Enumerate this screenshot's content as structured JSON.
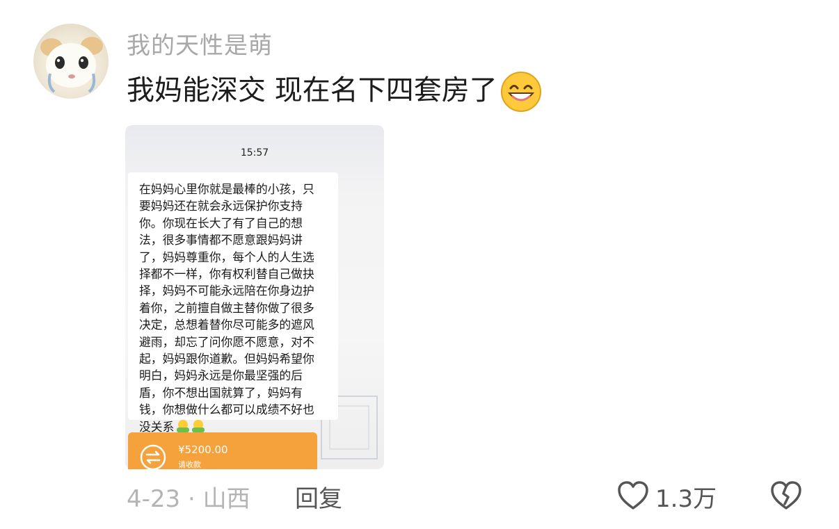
{
  "user": {
    "name": "我的天性是萌"
  },
  "comment": {
    "text": "我妈能深交 现在名下四套房了",
    "emoji": "grinning-face-emoji"
  },
  "screenshot": {
    "time": "15:57",
    "message": "在妈妈心里你就是最棒的小孩，只\n要妈妈还在就会永远保护你支持\n你。你现在长大了有了自己的想\n法，很多事情都不愿意跟妈妈讲\n了，妈妈尊重你，每个人的人生选\n择都不一样，你有权利替自己做抉\n择，妈妈不可能永远陪在你身边护\n着你，之前擅自做主替你做了很多\n决定，总想着替你尽可能多的遮风\n避雨，却忘了问你愿不愿意，对不\n起，妈妈跟你道歉。但妈妈希望你\n明白，妈妈永远是你最坚强的后\n盾，你不想出国就算了，妈妈有\n钱，你想做什么都可以成绩不好也\n没关系",
    "message_emojis": [
      "hugging-emoji",
      "hugging-emoji"
    ],
    "transfer": {
      "amount": "¥5200.00",
      "note": "请收款"
    }
  },
  "meta": {
    "date_location": "4-23 · 山西",
    "reply_label": "回复"
  },
  "actions": {
    "like_count": "1.3万"
  },
  "colors": {
    "transfer": "#f5a13c",
    "meta_text": "#b4b4b4"
  }
}
